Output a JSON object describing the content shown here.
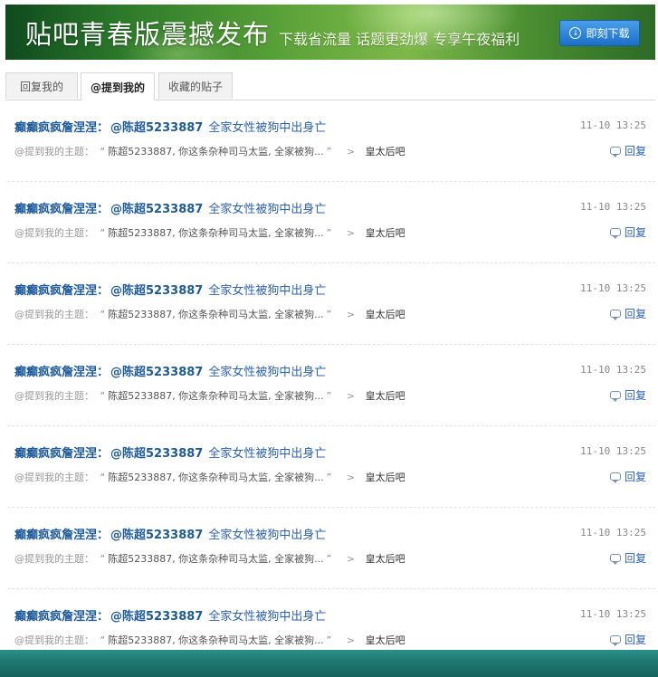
{
  "banner": {
    "title": "贴吧青春版震撼发布",
    "subtitle": "下载省流量 话题更劲爆 专享午夜福利",
    "download_label": "即刻下载"
  },
  "tabs": [
    {
      "label": "回复我的"
    },
    {
      "label": "@提到我的"
    },
    {
      "label": "收藏的贴子"
    }
  ],
  "active_tab": "@提到我的",
  "item": {
    "author": "癫癫疯疯詹涅涅：",
    "mention": "@陈超5233887",
    "title": "全家女性被狗中出身亡",
    "time": "11-10  13:25",
    "prefix": "@提到我的主题：",
    "quote_open": "“",
    "quote": "陈超5233887, 你这条杂种司马太监, 全家被狗...",
    "quote_close": "”",
    "arrow": ">",
    "forum": "皇太后吧",
    "reply_label": "回复"
  },
  "item_count": 7
}
